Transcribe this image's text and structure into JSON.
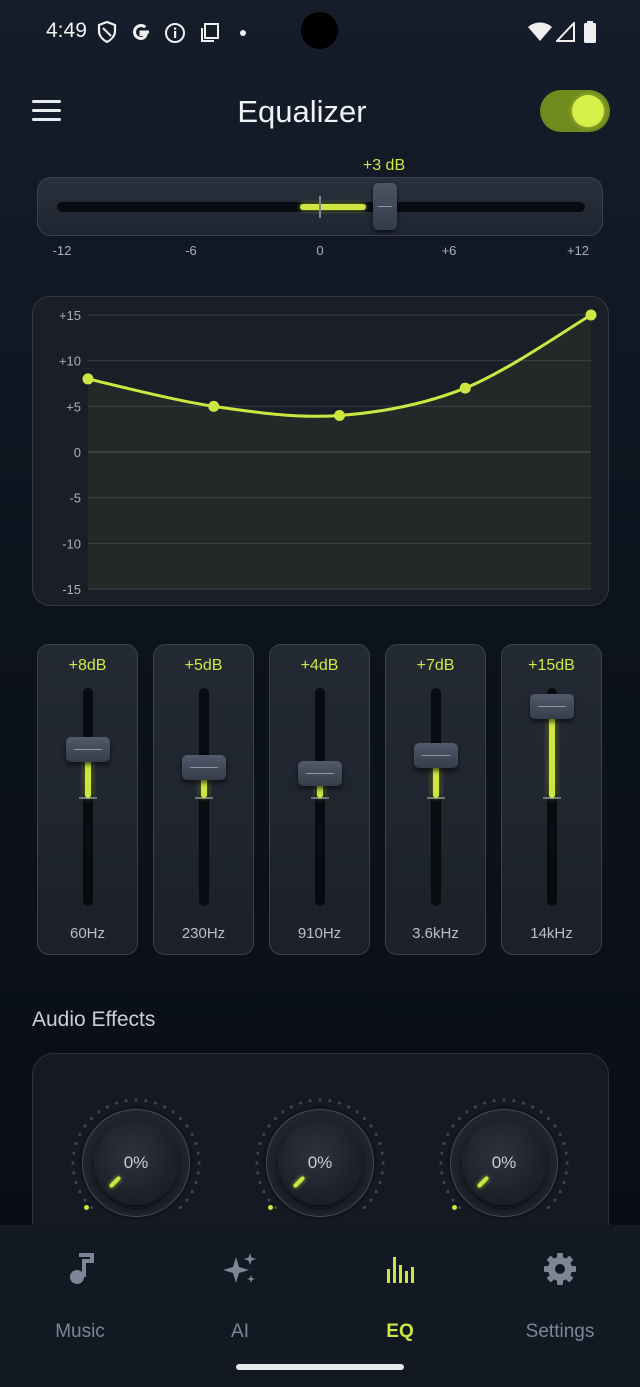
{
  "status_bar": {
    "time": "4:49"
  },
  "header": {
    "title": "Equalizer",
    "enabled": true
  },
  "preamp": {
    "value_label": "+3 dB",
    "value_db": 3,
    "ticks": [
      "-12",
      "-6",
      "0",
      "+6",
      "+12"
    ]
  },
  "curve": {
    "y_ticks": [
      "+15",
      "+10",
      "+5",
      "0",
      "-5",
      "-10",
      "-15"
    ],
    "points_db": [
      8,
      5,
      4,
      7,
      15
    ]
  },
  "bands": [
    {
      "value_label": "+8dB",
      "db": 8,
      "freq": "60Hz"
    },
    {
      "value_label": "+5dB",
      "db": 5,
      "freq": "230Hz"
    },
    {
      "value_label": "+4dB",
      "db": 4,
      "freq": "910Hz"
    },
    {
      "value_label": "+7dB",
      "db": 7,
      "freq": "3.6kHz"
    },
    {
      "value_label": "+15dB",
      "db": 15,
      "freq": "14kHz"
    }
  ],
  "effects": {
    "title": "Audio Effects",
    "knobs": [
      {
        "value": "0%"
      },
      {
        "value": "0%"
      },
      {
        "value": "0%"
      }
    ]
  },
  "nav": {
    "items": [
      {
        "label": "Music",
        "icon": "music-note-icon"
      },
      {
        "label": "AI",
        "icon": "sparkles-icon"
      },
      {
        "label": "EQ",
        "icon": "equalizer-bars-icon",
        "active": true
      },
      {
        "label": "Settings",
        "icon": "gear-icon"
      }
    ]
  },
  "colors": {
    "accent": "#cde641",
    "background": "#0d131d",
    "card": "#1a1f27"
  }
}
